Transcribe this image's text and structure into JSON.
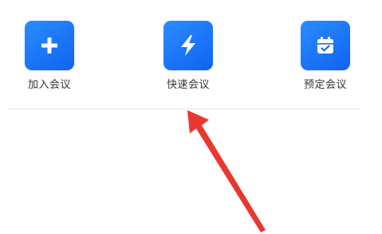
{
  "actions": [
    {
      "label": "加入会议",
      "icon": "plus-icon"
    },
    {
      "label": "快速会议",
      "icon": "lightning-icon"
    },
    {
      "label": "预定会议",
      "icon": "calendar-check-icon"
    }
  ],
  "colors": {
    "tile": "#1677ff",
    "label": "#333333",
    "annotation_arrow": "#e8382f",
    "divider": "#e6e6e6"
  }
}
